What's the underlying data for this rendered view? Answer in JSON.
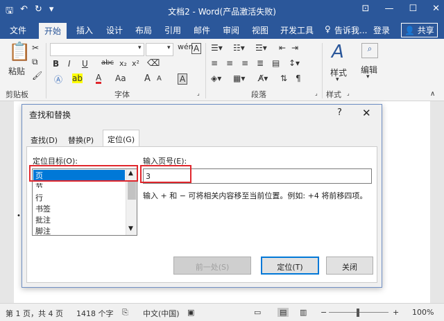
{
  "app": {
    "title": "文档2 - Word(产品激活失败)",
    "qat_icons": [
      "save-icon",
      "undo-icon",
      "redo-icon",
      "customize-icon"
    ],
    "window_buttons": [
      "ribbon-display-icon",
      "minimize-icon",
      "maximize-icon",
      "close-icon"
    ]
  },
  "menu": {
    "tabs": [
      "文件",
      "开始",
      "插入",
      "设计",
      "布局",
      "引用",
      "邮件",
      "审阅",
      "视图",
      "开发工具"
    ],
    "active": "开始",
    "tell_me": "告诉我...",
    "login": "登录",
    "share": "共享"
  },
  "ribbon": {
    "clipboard": {
      "label": "剪贴板",
      "paste": "粘贴"
    },
    "font": {
      "label": "字体",
      "wen": "wén",
      "bold": "B",
      "italic": "I",
      "underline": "U",
      "strike": "abc",
      "sub": "x₂",
      "sup": "x²",
      "font_color": "A",
      "aa": "Aa",
      "grow": "A",
      "shrink": "A",
      "char_border": "A"
    },
    "paragraph": {
      "label": "段落"
    },
    "styles": {
      "label": "样式",
      "button": "样式"
    },
    "editing": {
      "button": "编辑"
    }
  },
  "dialog": {
    "title": "查找和替换",
    "help": "?",
    "close": "✕",
    "tabs": [
      "查找(D)",
      "替换(P)",
      "定位(G)"
    ],
    "active_tab": "定位(G)",
    "goto_what_label": "定位目标(O):",
    "goto_targets": [
      "页",
      "节",
      "行",
      "书签",
      "批注",
      "脚注"
    ],
    "selected_target": "页",
    "page_number_label": "输入页号(E):",
    "page_number_value": "3",
    "hint": "输入 + 和 − 可将相关内容移至当前位置。例如: +4 将前移四项。",
    "buttons": {
      "previous": "前一处(S)",
      "goto": "定位(T)",
      "close": "关闭"
    }
  },
  "status": {
    "page": "第 1 页，共 4 页",
    "words": "1418 个字",
    "language": "中文(中国)",
    "zoom": "100%"
  },
  "colors": {
    "accent": "#2b579a",
    "highlight": "#e0262c",
    "selection": "#0078d7"
  }
}
